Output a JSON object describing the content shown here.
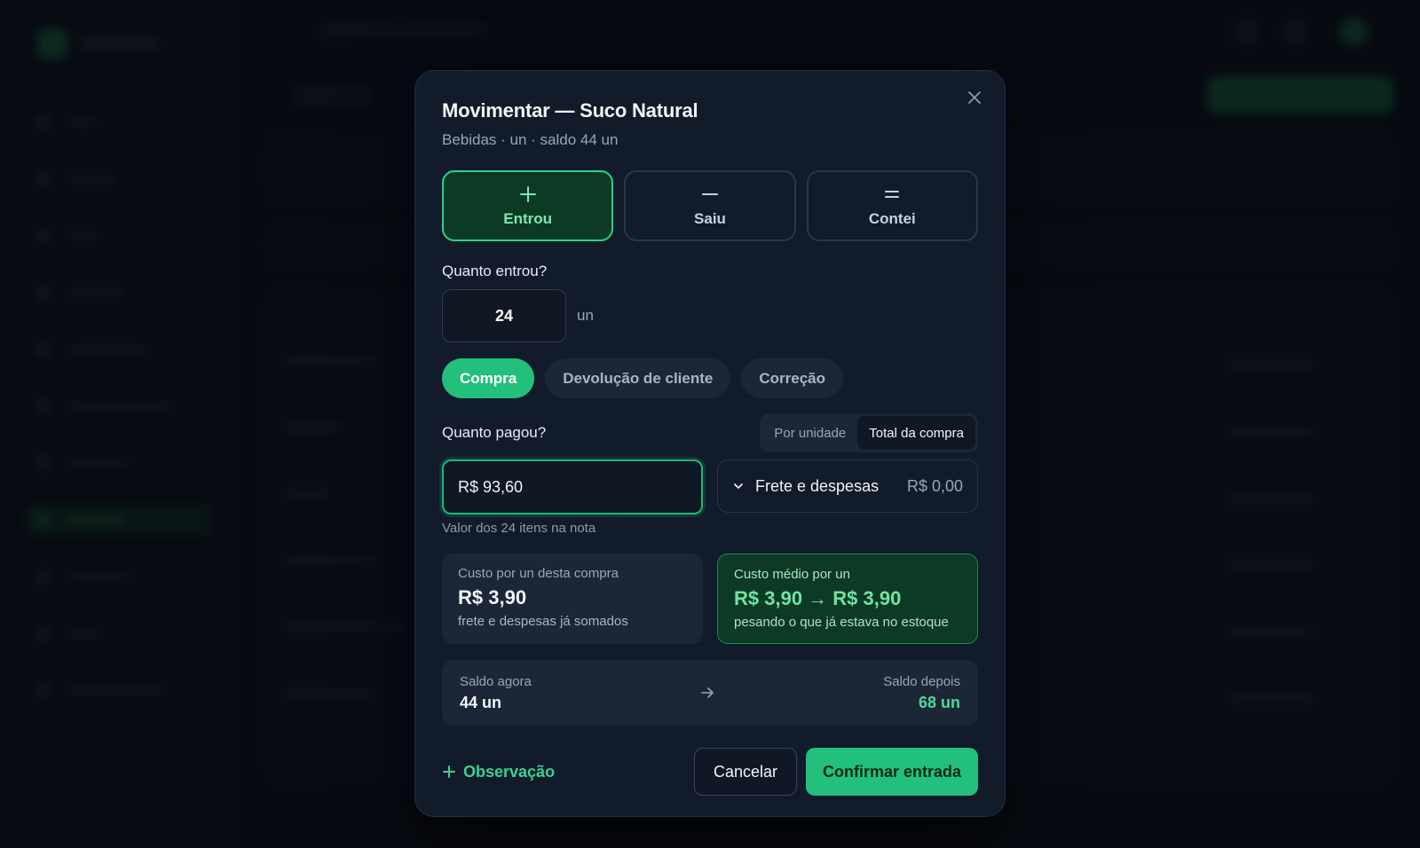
{
  "modal": {
    "title": "Movimentar — Suco Natural",
    "subtitle": "Bebidas · un · saldo 44 un",
    "close_icon": "close-icon",
    "types": [
      {
        "label": "Entrou",
        "icon": "plus-icon",
        "active": true
      },
      {
        "label": "Saiu",
        "icon": "minus-icon",
        "active": false
      },
      {
        "label": "Contei",
        "icon": "equals-icon",
        "active": false
      }
    ],
    "quantity": {
      "label": "Quanto entrou?",
      "value": "24",
      "unit": "un"
    },
    "reasons": [
      {
        "label": "Compra",
        "active": true
      },
      {
        "label": "Devolução de cliente",
        "active": false
      },
      {
        "label": "Correção",
        "active": false
      }
    ],
    "payment": {
      "label": "Quanto pagou?",
      "modes": [
        {
          "label": "Por unidade",
          "active": false
        },
        {
          "label": "Total da compra",
          "active": true
        }
      ],
      "value": "R$ 93,60",
      "hint": "Valor dos 24 itens na nota",
      "freight_label": "Frete e despesas",
      "freight_value": "R$ 0,00"
    },
    "unit_cost": {
      "label": "Custo por un desta compra",
      "value": "R$ 3,90",
      "sub": "frete e despesas já somados"
    },
    "avg_cost": {
      "label": "Custo médio por un",
      "value": "R$ 3,90 → R$ 3,90",
      "sub": "pesando o que já estava no estoque"
    },
    "balance": {
      "now_label": "Saldo agora",
      "now_value": "44 un",
      "after_label": "Saldo depois",
      "after_value": "68 un"
    },
    "footer": {
      "note_label": "Observação",
      "cancel_label": "Cancelar",
      "confirm_label": "Confirmar entrada"
    }
  },
  "colors": {
    "accent": "#22c07c",
    "accent_dark": "#0c3a24",
    "surface": "#111b29",
    "muted": "#1b2636"
  }
}
